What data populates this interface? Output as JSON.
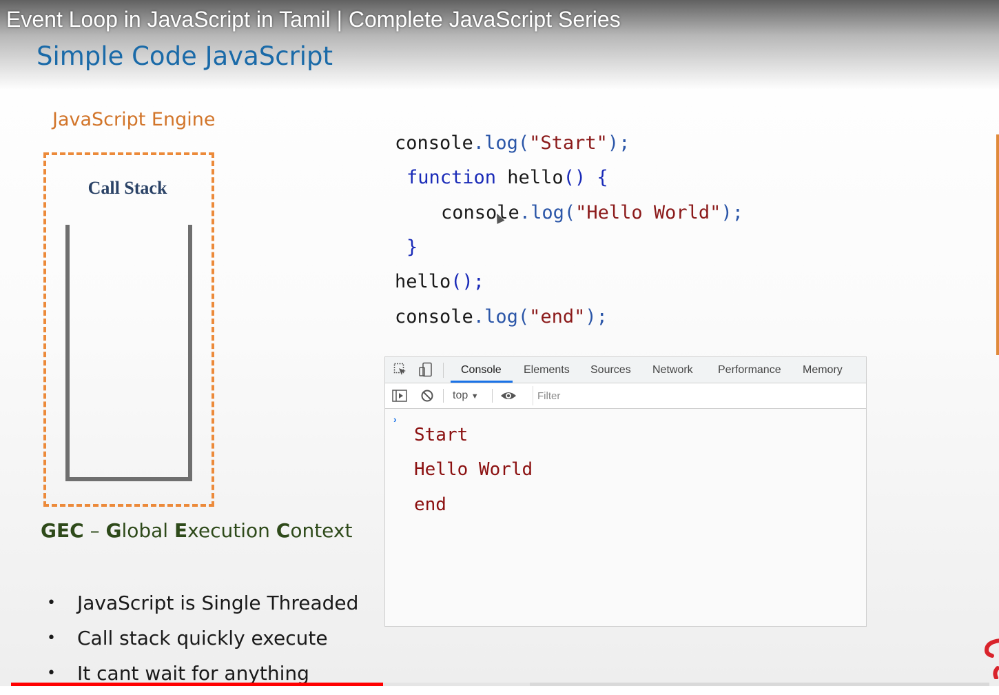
{
  "video": {
    "title": "Event Loop in JavaScript in Tamil | Complete JavaScript Series",
    "progress_fraction": 0.38,
    "buffered_fraction": 0.53
  },
  "slide": {
    "title": "Simple Code JavaScript",
    "engine_label": "JavaScript Engine",
    "call_stack_label": "Call Stack",
    "gec": {
      "abbr": "GEC",
      "dash": "–",
      "g": "G",
      "lobal": "lobal",
      "e": "E",
      "xecution": "xecution",
      "c": "C",
      "ontext": "ontext"
    },
    "bullets": [
      "JavaScript is Single Threaded",
      "Call stack quickly execute",
      "It cant wait for anything"
    ]
  },
  "code": {
    "line1": {
      "obj": "console",
      "dot": ".",
      "method": "log",
      "open": "(",
      "arg": "\"Start\"",
      "close": ");"
    },
    "line2": {
      "kw": "function",
      "name": " hello",
      "parens": "()",
      "brace": " {"
    },
    "line3": {
      "obj": "console",
      "dot": ".",
      "method": "log",
      "open": "(",
      "arg": "\"Hello World\"",
      "close": ");"
    },
    "line4": {
      "brace": "}"
    },
    "line5": {
      "name": "hello",
      "call": "();"
    },
    "line6": {
      "obj": "console",
      "dot": ".",
      "method": "log",
      "open": "(",
      "arg": "\"end\"",
      "close": ");"
    }
  },
  "devtools": {
    "tabs": [
      "Console",
      "Elements",
      "Sources",
      "Network",
      "Performance",
      "Memory"
    ],
    "active_tab": "Console",
    "context": "top",
    "filter_placeholder": "Filter",
    "prompt": "›",
    "output": [
      "Start",
      "Hello World",
      "end"
    ]
  },
  "colors": {
    "slide_title": "#1a6aa8",
    "engine_label": "#d2752a",
    "engine_border": "#ec8a3a",
    "gec_text": "#2e4a1a",
    "console_output": "#8b1010",
    "progress": "#ff0000"
  }
}
